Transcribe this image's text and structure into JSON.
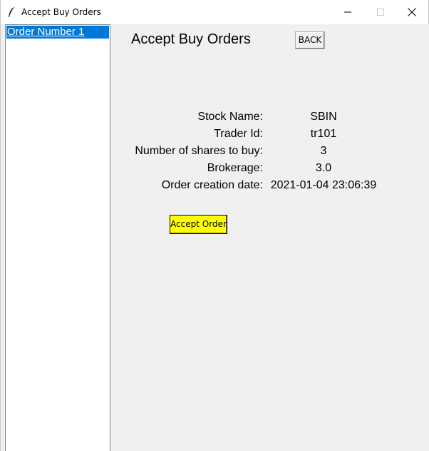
{
  "window": {
    "title": "Accept Buy Orders"
  },
  "orders": {
    "items": [
      {
        "label": "Order Number 1"
      }
    ]
  },
  "main": {
    "title": "Accept Buy Orders",
    "back_label": "BACK",
    "details": [
      {
        "label": "Stock Name:",
        "value": "SBIN"
      },
      {
        "label": "Trader Id:",
        "value": "tr101"
      },
      {
        "label": "Number of shares to buy:",
        "value": "3"
      },
      {
        "label": "Brokerage:",
        "value": "3.0"
      },
      {
        "label": "Order creation date:",
        "value": "2021-01-04 23:06:39"
      }
    ],
    "accept_label": "Accept Order"
  },
  "colors": {
    "selection": "#0078d7",
    "accept_button": "#ffff00",
    "background": "#f0f0f0"
  },
  "icons": {
    "app": "feather-icon",
    "minimize": "minimize-icon",
    "maximize": "maximize-icon",
    "close": "close-icon"
  }
}
